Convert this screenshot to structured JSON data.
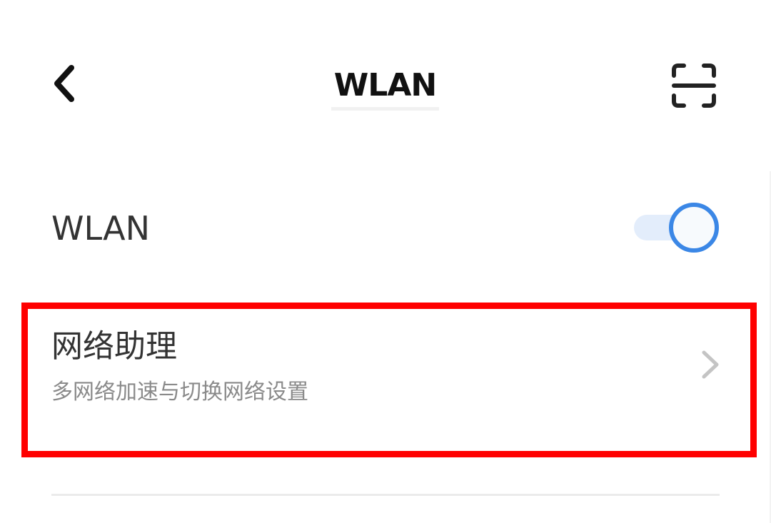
{
  "header": {
    "title": "WLAN",
    "back_icon": "back-arrow-icon",
    "scan_icon": "scan-icon"
  },
  "wlan": {
    "label": "WLAN",
    "enabled": true,
    "accent_color": "#3b87e6"
  },
  "assistant": {
    "title": "网络助理",
    "subtitle": "多网络加速与切换网络设置",
    "chevron_icon": "chevron-right-icon"
  },
  "highlight_color": "#ff0000"
}
